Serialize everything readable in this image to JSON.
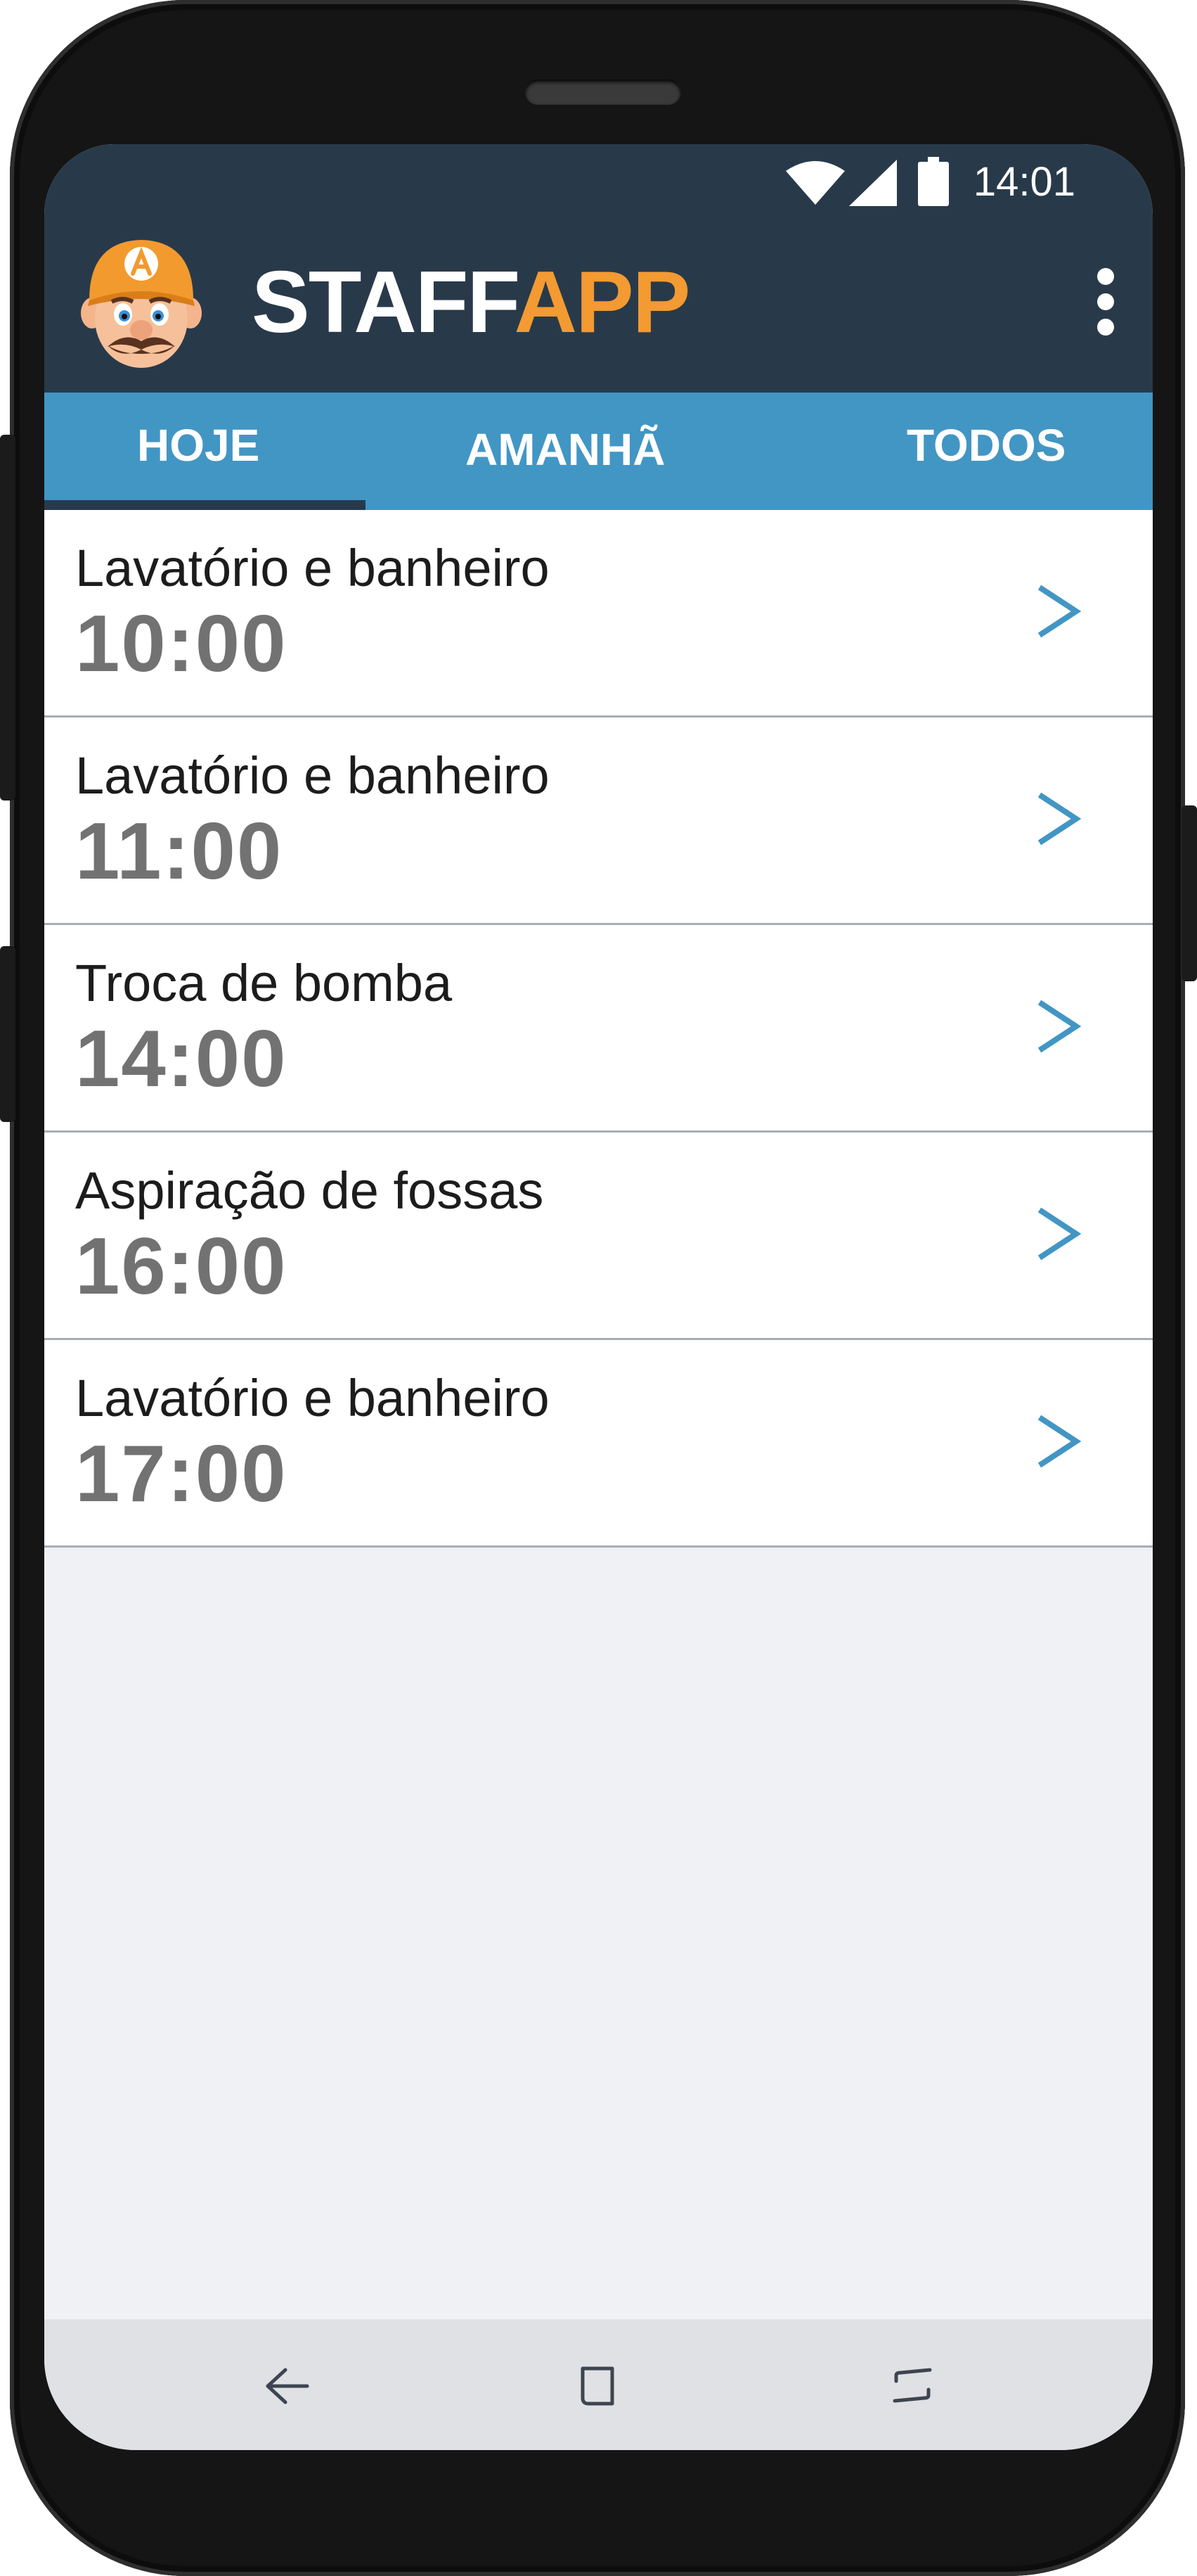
{
  "status_bar": {
    "time": "14:01",
    "icons": [
      "wifi-icon",
      "signal-icon",
      "battery-icon"
    ]
  },
  "app_bar": {
    "title_part1": "STAFF",
    "title_part2": "APP",
    "logo": "mascot-logo",
    "menu_icon": "more-vertical-icon"
  },
  "tabs": [
    {
      "label": "HOJE",
      "selected": true
    },
    {
      "label": "AMANHÃ",
      "selected": false
    },
    {
      "label": "TODOS",
      "selected": false
    }
  ],
  "tasks": [
    {
      "title": "Lavatório e banheiro",
      "time": "10:00"
    },
    {
      "title": "Lavatório e banheiro",
      "time": "11:00"
    },
    {
      "title": "Troca de bomba",
      "time": "14:00"
    },
    {
      "title": "Aspiração de fossas",
      "time": "16:00"
    },
    {
      "title": "Lavatório e banheiro",
      "time": "17:00"
    }
  ],
  "nav_bar": {
    "buttons": [
      "back-icon",
      "home-icon",
      "recents-icon"
    ]
  },
  "colors": {
    "header_bg": "#283a4a",
    "tab_bg": "#4296c4",
    "accent_orange": "#f39a32",
    "chevron_blue": "#4296c4",
    "time_gray": "#727272",
    "list_bg": "#eff1f4"
  }
}
